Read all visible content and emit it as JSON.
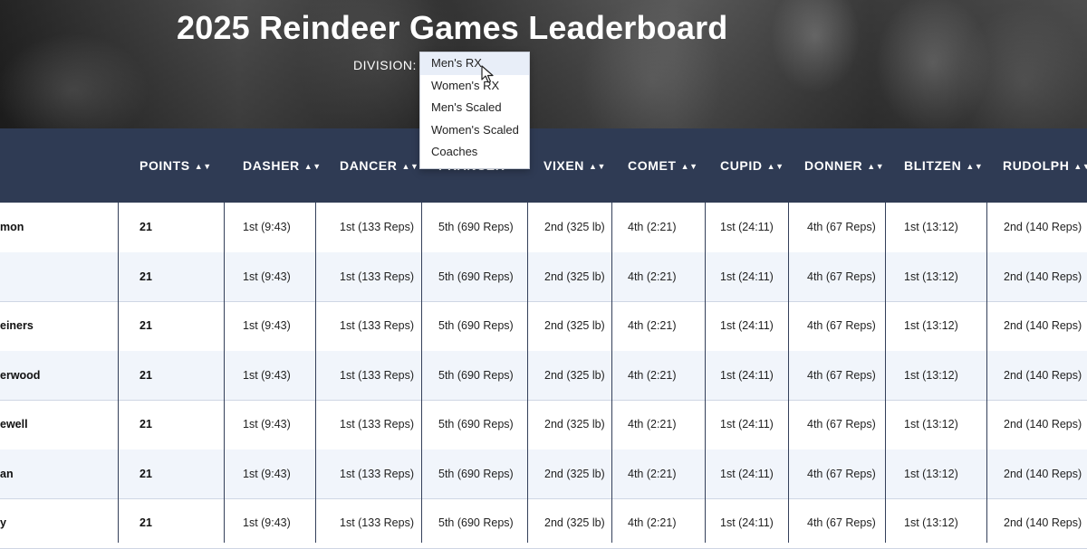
{
  "page": {
    "title": "2025 Reindeer Games Leaderboard",
    "division_label": "DIVISION:"
  },
  "division_dropdown": {
    "selected": "Men's RX",
    "options": [
      "Men's RX",
      "Women's RX",
      "Men's Scaled",
      "Women's Scaled",
      "Coaches"
    ]
  },
  "table": {
    "columns": [
      "POINTS",
      "DASHER",
      "DANCER",
      "PRANCER",
      "VIXEN",
      "COMET",
      "CUPID",
      "DONNER",
      "BLITZEN",
      "RUDOLPH"
    ],
    "sort_icon": "sort-arrows-icon",
    "rows": [
      [
        "mon",
        "21",
        "1st (9:43)",
        "1st (133 Reps)",
        "5th (690 Reps)",
        "2nd (325 lb)",
        "4th (2:21)",
        "1st (24:11)",
        "4th (67 Reps)",
        "1st (13:12)",
        "2nd (140 Reps)"
      ],
      [
        "",
        "21",
        "1st (9:43)",
        "1st (133 Reps)",
        "5th (690 Reps)",
        "2nd (325 lb)",
        "4th (2:21)",
        "1st (24:11)",
        "4th (67 Reps)",
        "1st (13:12)",
        "2nd (140 Reps)"
      ],
      [
        "einers",
        "21",
        "1st (9:43)",
        "1st (133 Reps)",
        "5th (690 Reps)",
        "2nd (325 lb)",
        "4th (2:21)",
        "1st (24:11)",
        "4th (67 Reps)",
        "1st (13:12)",
        "2nd (140 Reps)"
      ],
      [
        "erwood",
        "21",
        "1st (9:43)",
        "1st (133 Reps)",
        "5th (690 Reps)",
        "2nd (325 lb)",
        "4th (2:21)",
        "1st (24:11)",
        "4th (67 Reps)",
        "1st (13:12)",
        "2nd (140 Reps)"
      ],
      [
        "ewell",
        "21",
        "1st (9:43)",
        "1st (133 Reps)",
        "5th (690 Reps)",
        "2nd (325 lb)",
        "4th (2:21)",
        "1st (24:11)",
        "4th (67 Reps)",
        "1st (13:12)",
        "2nd (140 Reps)"
      ],
      [
        "an",
        "21",
        "1st (9:43)",
        "1st (133 Reps)",
        "5th (690 Reps)",
        "2nd (325 lb)",
        "4th (2:21)",
        "1st (24:11)",
        "4th (67 Reps)",
        "1st (13:12)",
        "2nd (140 Reps)"
      ],
      [
        "y",
        "21",
        "1st (9:43)",
        "1st (133 Reps)",
        "5th (690 Reps)",
        "2nd (325 lb)",
        "4th (2:21)",
        "1st (24:11)",
        "4th (67 Reps)",
        "1st (13:12)",
        "2nd (140 Reps)"
      ]
    ]
  },
  "colors": {
    "header_bg": "#2f3b54",
    "row_alt_bg": "#f1f5fb",
    "divider": "#34405a"
  }
}
